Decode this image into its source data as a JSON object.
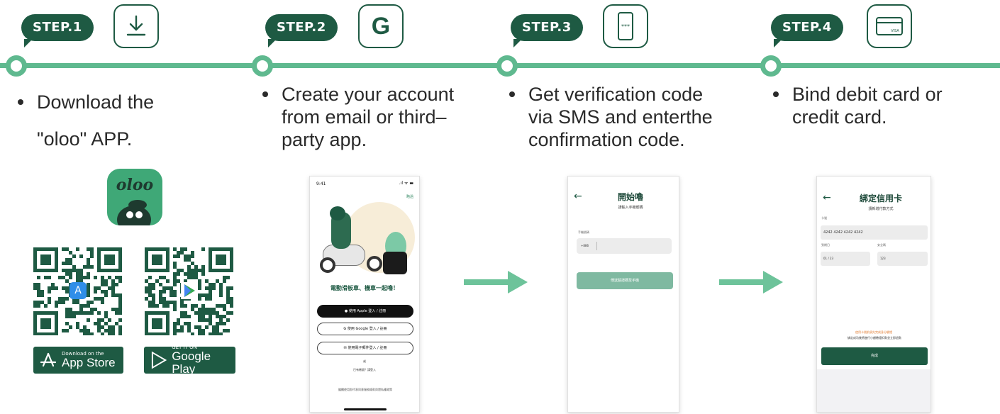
{
  "steps": [
    {
      "badge": "STEP.1",
      "icon": "download-icon",
      "desc_lines": [
        "Download the",
        "\"oloo\" APP."
      ]
    },
    {
      "badge": "STEP.2",
      "icon": "google-g-icon",
      "icon_text": "G",
      "desc_lines": [
        "Create your account",
        "from email or third–",
        "party app."
      ]
    },
    {
      "badge": "STEP.3",
      "icon": "phone-sms-icon",
      "desc_lines": [
        "Get verification code",
        "via SMS and enterthe",
        "confirmation code."
      ]
    },
    {
      "badge": "STEP.4",
      "icon": "credit-card-icon",
      "icon_text": "VISA",
      "desc_lines": [
        "Bind debit card or",
        "credit card."
      ]
    }
  ],
  "app": {
    "logo_text": "oloo",
    "app_store": {
      "small": "Download on the",
      "big": "App Store"
    },
    "google_play": {
      "small": "GET IT ON",
      "big": "Google Play"
    }
  },
  "phone2": {
    "time": "9:41",
    "status": ".ıl ᯤ ▬",
    "skip": "略過",
    "slogan": "電動滑板車、機車一起嚕！",
    "apple_btn": "● 使用 Apple 登入 / 註冊",
    "google_btn": "G 使用 Google 登入 / 註冊",
    "email_btn": "✉ 使用電子郵件登入 / 註冊",
    "or": "或",
    "login_line": "已有帳號？請登入",
    "terms": "繼續使用即代表同意服務條款與隱私權政策"
  },
  "phone3": {
    "title": "開始嚕",
    "subtitle": "請輸入手機號碼",
    "field_label": "手機號碼",
    "prefix": "+886",
    "button": "傳送驗證碼至手機"
  },
  "phone4": {
    "title": "綁定信用卡",
    "subtitle": "請新增付款方式",
    "card_label": "卡號",
    "card_value": "4242 4242 4242 4242",
    "expiry_label": "到期日",
    "expiry_value": "01 / 23",
    "cvc_label": "安全碼",
    "cvc_value": "123",
    "notice_orange": "使用卡號前須先完成身分驗證",
    "notice_black": "綁定成功後將進行小額驗證扣款並立即退款",
    "done": "完成"
  },
  "colors": {
    "dark_green": "#1e5a43",
    "line_green": "#5fb98f",
    "arrow_green": "#6dc39a",
    "light_green": "#7fb9a1"
  }
}
